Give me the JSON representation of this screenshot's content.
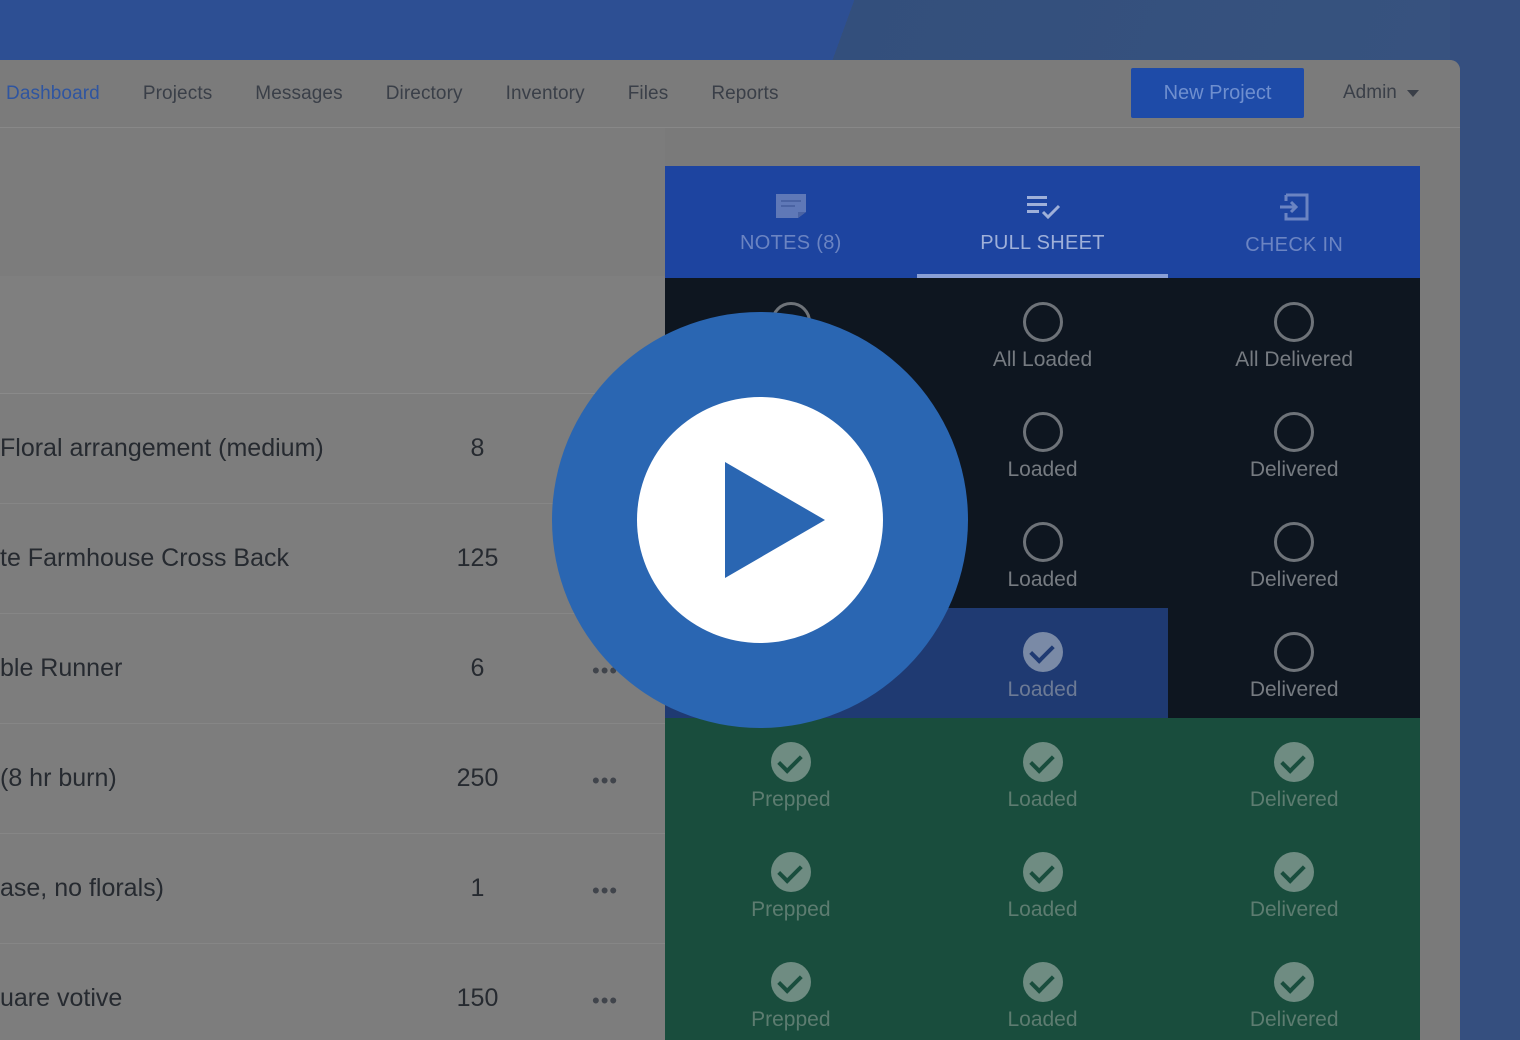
{
  "navbar": {
    "items": [
      {
        "label": "Dashboard",
        "active": true
      },
      {
        "label": "Projects"
      },
      {
        "label": "Messages"
      },
      {
        "label": "Directory"
      },
      {
        "label": "Inventory"
      },
      {
        "label": "Files"
      },
      {
        "label": "Reports"
      }
    ],
    "new_project_label": "New Project",
    "admin_label": "Admin"
  },
  "list": {
    "rows": [
      {
        "name": "Floral arrangement (medium)",
        "qty": "8",
        "more": ""
      },
      {
        "name": "te Farmhouse Cross Back",
        "qty": "125",
        "more": ""
      },
      {
        "name": "ble Runner",
        "qty": "6",
        "more": "•••"
      },
      {
        "name": "(8 hr burn)",
        "qty": "250",
        "more": "•••"
      },
      {
        "name": "ase, no florals)",
        "qty": "1",
        "more": "•••"
      },
      {
        "name": "uare votive",
        "qty": "150",
        "more": "•••"
      }
    ]
  },
  "panel": {
    "tabs": [
      {
        "label": "NOTES (8)",
        "icon": "note-icon"
      },
      {
        "label": "PULL SHEET",
        "icon": "checklist-icon",
        "active": true
      },
      {
        "label": "CHECK IN",
        "icon": "check-in-icon"
      }
    ],
    "grid": [
      [
        {
          "label": "",
          "state": "empty"
        },
        {
          "label": "All Loaded",
          "state": "empty"
        },
        {
          "label": "All Delivered",
          "state": "empty"
        }
      ],
      [
        {
          "label": "",
          "state": "empty"
        },
        {
          "label": "Loaded",
          "state": "empty"
        },
        {
          "label": "Delivered",
          "state": "empty"
        }
      ],
      [
        {
          "label": "",
          "state": "empty"
        },
        {
          "label": "Loaded",
          "state": "empty"
        },
        {
          "label": "Delivered",
          "state": "empty"
        }
      ],
      [
        {
          "label": "",
          "state": "done-blue"
        },
        {
          "label": "Loaded",
          "state": "done-blue"
        },
        {
          "label": "Delivered",
          "state": "empty"
        }
      ],
      [
        {
          "label": "Prepped",
          "state": "done-green"
        },
        {
          "label": "Loaded",
          "state": "done-green"
        },
        {
          "label": "Delivered",
          "state": "done-green"
        }
      ],
      [
        {
          "label": "Prepped",
          "state": "done-green"
        },
        {
          "label": "Loaded",
          "state": "done-green"
        },
        {
          "label": "Delivered",
          "state": "done-green"
        }
      ],
      [
        {
          "label": "Prepped",
          "state": "done-green"
        },
        {
          "label": "Loaded",
          "state": "done-green"
        },
        {
          "label": "Delivered",
          "state": "done-green"
        }
      ]
    ]
  },
  "overlay": {
    "icon": "play-icon"
  }
}
